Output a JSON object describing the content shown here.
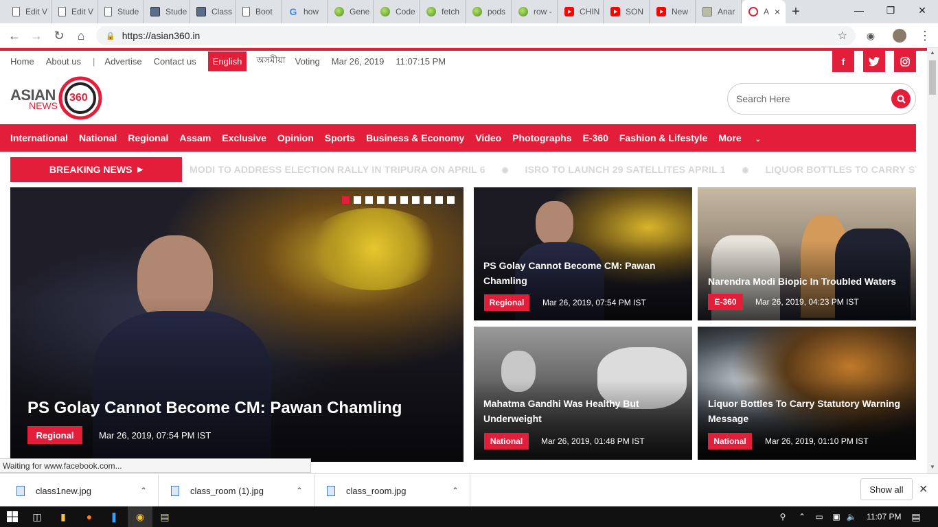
{
  "browser": {
    "tabs": [
      {
        "label": "Edit V",
        "icon": "document-icon"
      },
      {
        "label": "Edit V",
        "icon": "document-icon"
      },
      {
        "label": "Stude",
        "icon": "document-icon"
      },
      {
        "label": "Stude",
        "icon": "card-icon"
      },
      {
        "label": "Class",
        "icon": "card-icon"
      },
      {
        "label": "Boot",
        "icon": "document-icon"
      },
      {
        "label": "how",
        "icon": "google-icon"
      },
      {
        "label": "Gene",
        "icon": "ball-icon"
      },
      {
        "label": "Code",
        "icon": "ball-icon"
      },
      {
        "label": "fetch",
        "icon": "ball-icon"
      },
      {
        "label": "pods",
        "icon": "ball-icon"
      },
      {
        "label": "row -",
        "icon": "ball-icon"
      },
      {
        "label": "CHIN",
        "icon": "youtube-icon"
      },
      {
        "label": "SON",
        "icon": "youtube-icon"
      },
      {
        "label": "New",
        "icon": "youtube-icon"
      },
      {
        "label": "Anar",
        "icon": "photo-icon"
      },
      {
        "label": "A",
        "icon": "asian360-icon"
      }
    ],
    "url": "https://asian360.in"
  },
  "site": {
    "top_links": [
      "Home",
      "About us",
      "Advertise",
      "Contact us"
    ],
    "lang_active": "English",
    "lang_other": "অসমীয়া",
    "voting": "Voting",
    "date": "Mar 26, 2019",
    "time": "11:07:15 PM",
    "social": {
      "facebook": "f",
      "twitter": "t",
      "instagram": "i"
    },
    "logo": {
      "word1": "ASIAN",
      "word2": "NEWS",
      "num": "360"
    },
    "search_placeholder": "Search Here",
    "nav": [
      "International",
      "National",
      "Regional",
      "Assam",
      "Exclusive",
      "Opinion",
      "Sports",
      "Business & Economy",
      "Video",
      "Photographs",
      "E-360",
      "Fashion & Lifestyle",
      "More"
    ],
    "breaking_label": "BREAKING NEWS",
    "ticker": [
      "MODI TO ADDRESS ELECTION RALLY IN TRIPURA ON APRIL 6",
      "ISRO TO LAUNCH 29 SATELLITES APRIL 1",
      "LIQUOR BOTTLES TO CARRY STATUTOR"
    ],
    "hero": {
      "title": "PS Golay Cannot Become CM: Pawan Chamling",
      "category": "Regional",
      "date": "Mar 26, 2019, 07:54 PM IST",
      "slides": 10,
      "active_slide": 1
    },
    "cards": [
      {
        "title": "PS Golay Cannot Become CM: Pawan Chamling",
        "category": "Regional",
        "date": "Mar 26, 2019, 07:54 PM IST"
      },
      {
        "title": "Narendra Modi Biopic In Troubled Waters",
        "category": "E-360",
        "date": "Mar 26, 2019, 04:23 PM IST"
      },
      {
        "title": "Mahatma Gandhi Was Healthy But Underweight",
        "category": "National",
        "date": "Mar 26, 2019, 01:48 PM IST"
      },
      {
        "title": "Liquor Bottles To Carry Statutory Warning Message",
        "category": "National",
        "date": "Mar 26, 2019, 01:10 PM IST"
      }
    ]
  },
  "status_text": "Waiting for www.facebook.com...",
  "downloads": {
    "items": [
      "class1new.jpg",
      "class_room (1).jpg",
      "class_room.jpg"
    ],
    "show_all": "Show all"
  },
  "taskbar": {
    "time": "11:07 PM"
  },
  "colors": {
    "accent": "#e31e3a"
  }
}
